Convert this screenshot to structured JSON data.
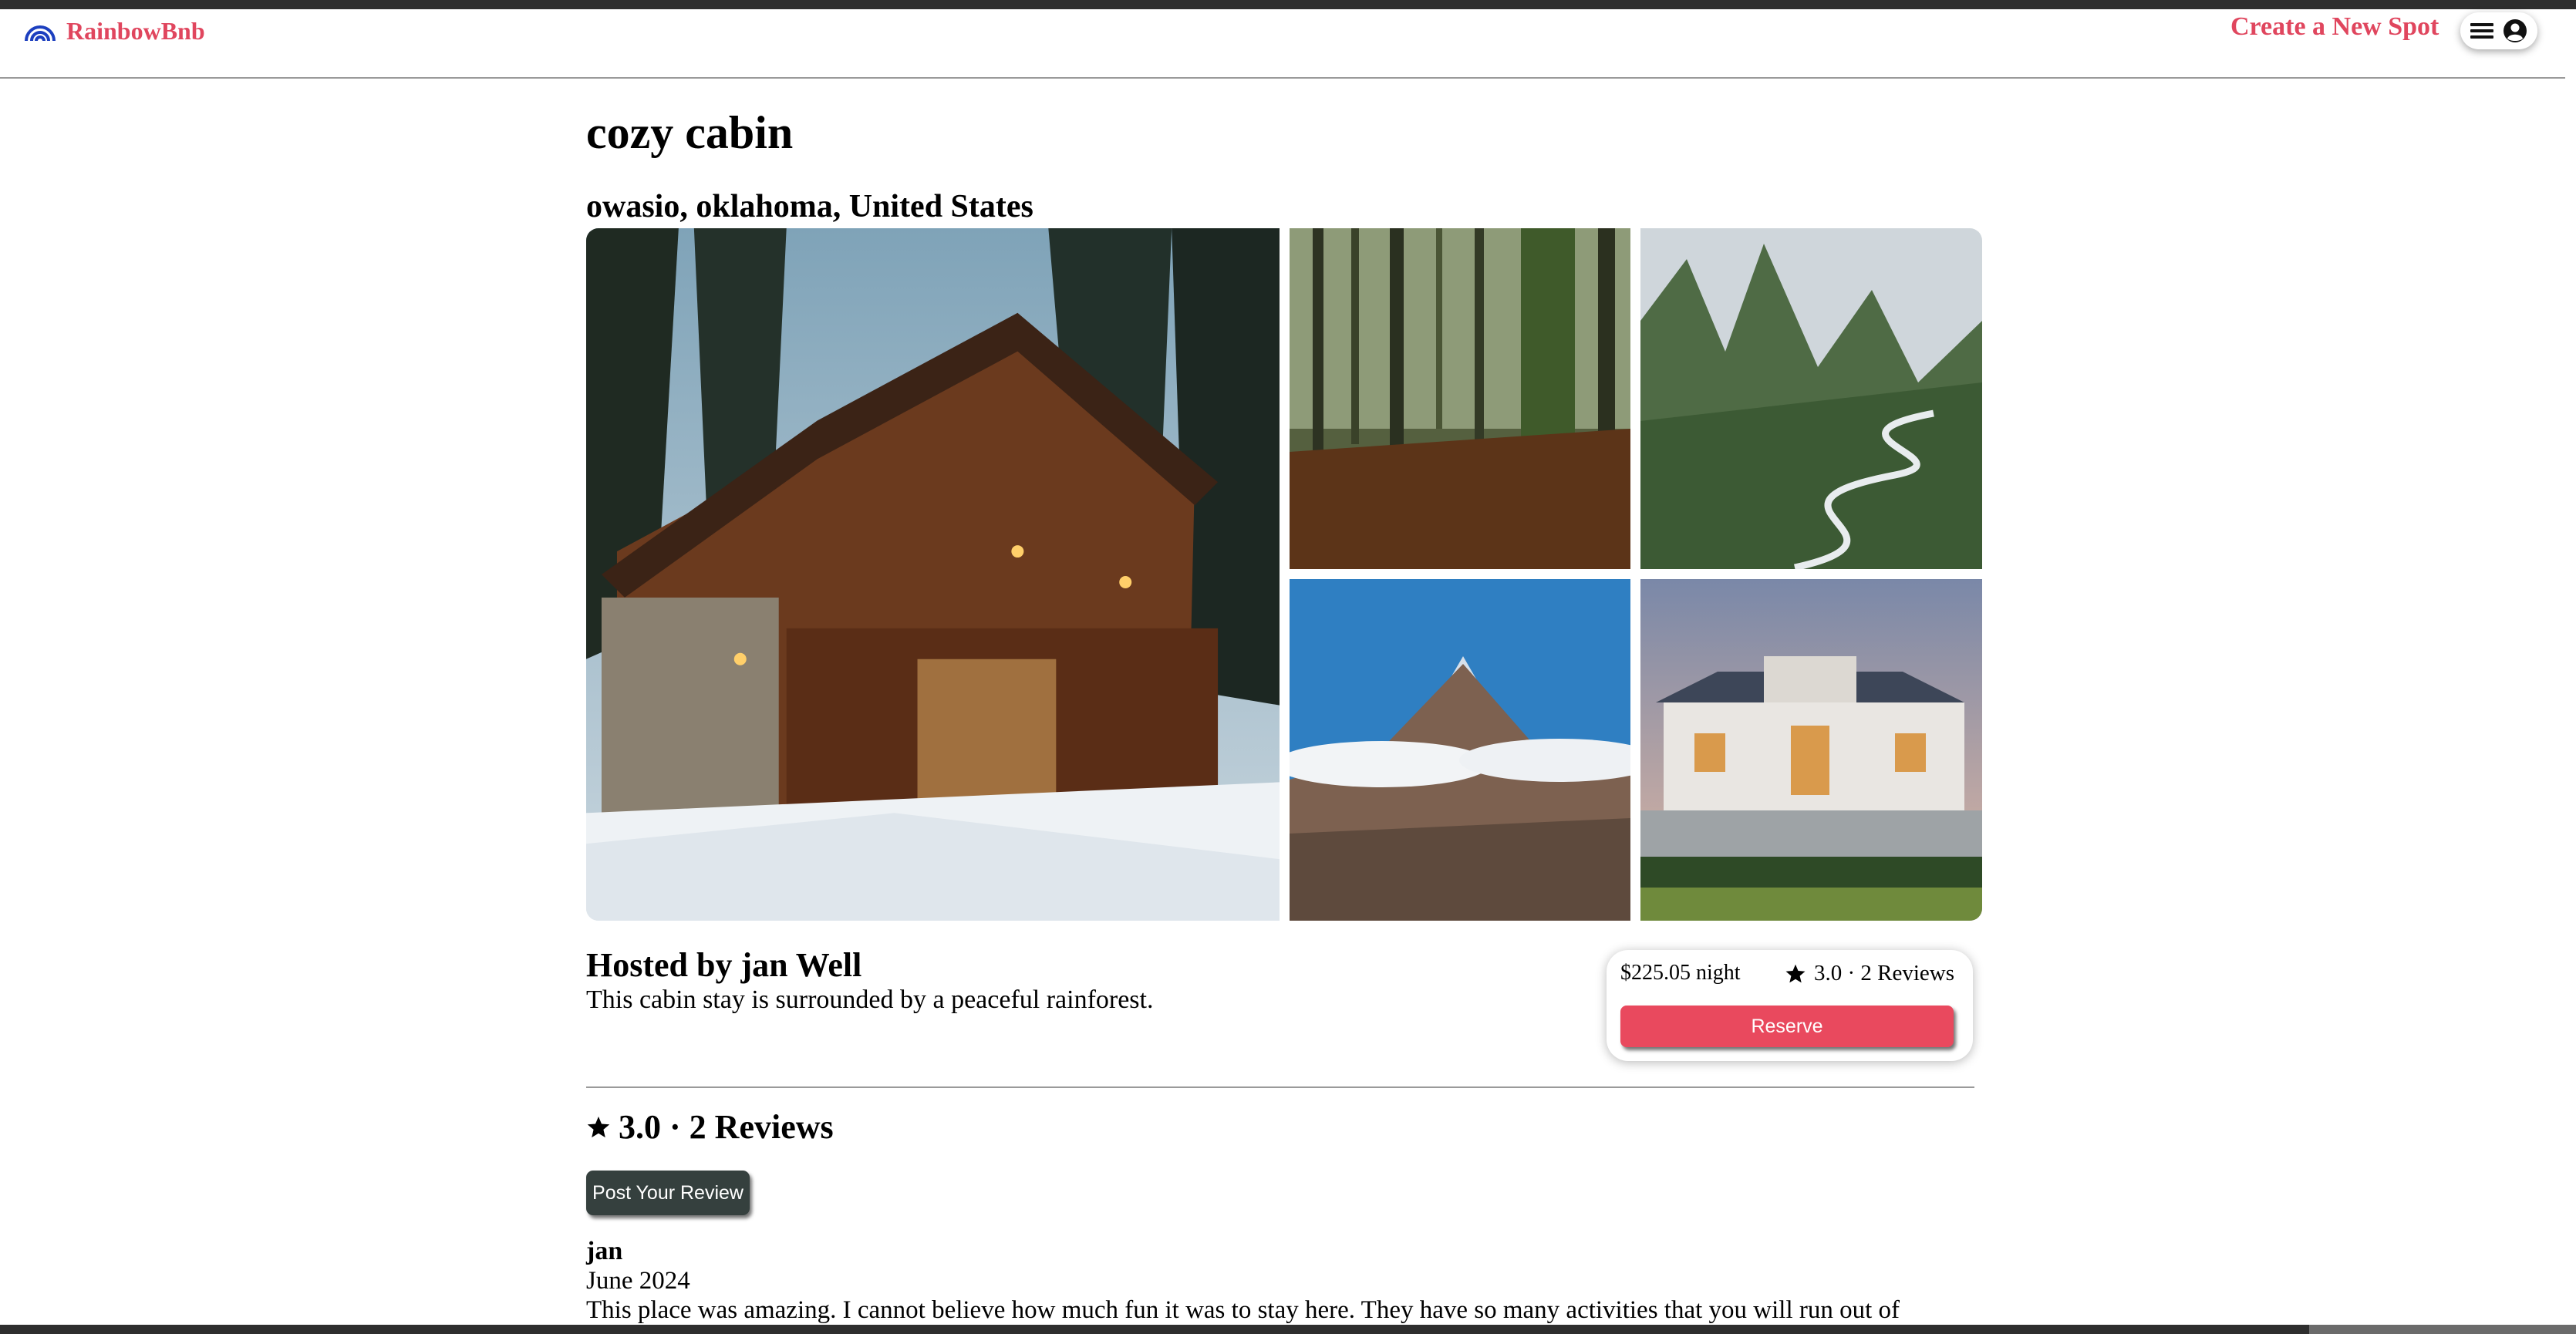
{
  "nav": {
    "logo_text": "RainbowBnb",
    "create_spot_label": "Create a New Spot",
    "menu_icon": "hamburger-menu-icon",
    "profile_icon": "user-circle-icon"
  },
  "spot": {
    "name": "cozy cabin",
    "location": "owasio, oklahoma, United States",
    "images": [
      "snowy wooden cabin with stone wall",
      "misty forest trees",
      "green mountains with winding road",
      "snow capped mountain peak",
      "large modern mansion at dusk"
    ],
    "hosted_by": "Hosted by jan Well",
    "description": "This cabin stay is surrounded by a peaceful rainforest."
  },
  "callout": {
    "price": "$225.05 night",
    "rating_text": "3.0 · 2 Reviews",
    "reserve_label": "Reserve"
  },
  "reviews": {
    "summary": "3.0 · 2 Reviews",
    "post_label": "Post Your Review",
    "items": [
      {
        "user": "jan",
        "date": "June 2024",
        "text": "This place was amazing. I cannot believe how much fun it was to stay here. They have so many activities that you will run out of"
      }
    ]
  },
  "colors": {
    "brand": "#e0465e",
    "reserve": "#e9495e",
    "post_button": "#35403e"
  }
}
